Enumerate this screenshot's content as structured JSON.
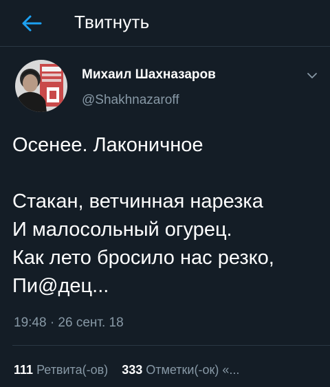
{
  "header": {
    "title": "Твитнуть",
    "back_icon": "arrow-left-icon",
    "accent_color": "#1da1f2"
  },
  "tweet": {
    "author": {
      "name": "Михаил Шахназаров",
      "handle": "@Shakhnazaroff",
      "avatar_icon": "user-avatar"
    },
    "menu_icon": "chevron-down-icon",
    "text_lines": [
      "Осенее. Лаконичное",
      "",
      "Стакан, ветчинная нарезка",
      "И малосольный огурец.",
      "Как лето бросило нас резко,",
      "Пи@дец..."
    ],
    "timestamp": "19:48 · 26 сент. 18",
    "stats": {
      "retweets_count": "111",
      "retweets_label": "Ретвита(-ов)",
      "likes_count": "333",
      "likes_label": "Отметки(-ок) «..."
    }
  }
}
